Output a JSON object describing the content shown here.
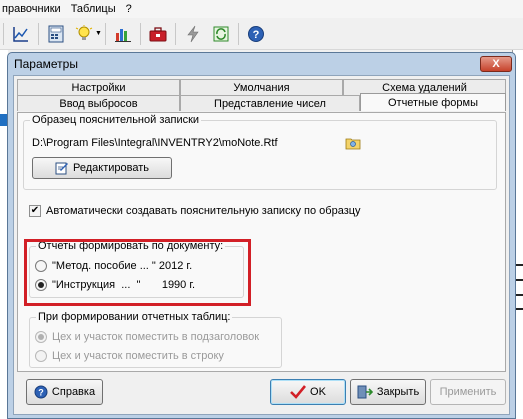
{
  "app": {
    "menu": [
      "правочники",
      "Таблицы",
      "?"
    ]
  },
  "toolbar_icons": [
    "chart-line-icon",
    "calculator-icon",
    "lightbulb-icon",
    "bar-chart-icon",
    "toolbox-icon",
    "lightning-icon",
    "refresh-icon",
    "help-icon"
  ],
  "dialog": {
    "title": "Параметры",
    "close_label": "X",
    "tabs_row1": [
      "Настройки",
      "Умолчания",
      "Схема удалений"
    ],
    "tabs_row2": [
      "Ввод выбросов",
      "Представление чисел",
      "Отчетные формы"
    ],
    "active_tab": "Отчетные формы",
    "sample_group": {
      "title": "Образец пояснительной записки",
      "path": "D:\\Program Files\\Integral\\INVENTRY2\\moNote.Rtf",
      "edit_label": "Редактировать"
    },
    "auto_create": {
      "label": "Автоматически создавать пояснительную записку по образцу",
      "checked": true
    },
    "reports_group": {
      "title": "Отчеты формировать по документу:",
      "options": [
        {
          "label": "\"Метод. пособие ... \" 2012 г.",
          "selected": false
        },
        {
          "label": "\"Инструкция  ...  \"       1990 г.",
          "selected": true
        }
      ]
    },
    "tables_group": {
      "title": "При формировании отчетных таблиц:",
      "options": [
        {
          "label": "Цех и участок поместить в подзаголовок",
          "selected": true
        },
        {
          "label": "Цех и участок поместить в строку",
          "selected": false
        }
      ]
    },
    "buttons": {
      "help": "Справка",
      "ok": "OK",
      "close": "Закрыть",
      "apply": "Применить"
    }
  },
  "colors": {
    "highlight": "#d21f26",
    "title_bar": "#bcd0e6"
  }
}
